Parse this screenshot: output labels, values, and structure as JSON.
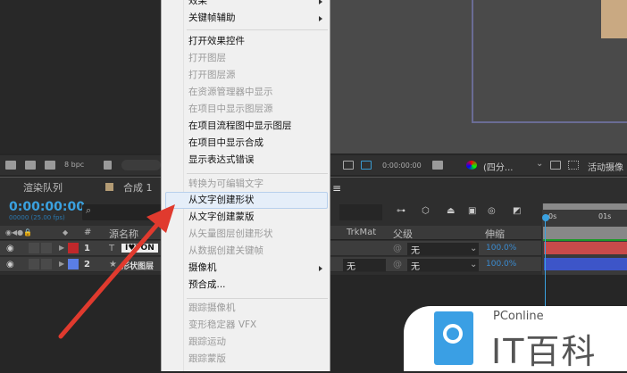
{
  "menu": {
    "items": [
      {
        "label": "效果",
        "disabled": false,
        "submenu": true
      },
      {
        "label": "关键帧辅助",
        "disabled": false,
        "submenu": true
      },
      {
        "label": "打开效果控件",
        "disabled": false
      },
      {
        "label": "打开图层",
        "disabled": true
      },
      {
        "label": "打开图层源",
        "disabled": true
      },
      {
        "label": "在资源管理器中显示",
        "disabled": true
      },
      {
        "label": "在项目中显示图层源",
        "disabled": true
      },
      {
        "label": "在项目流程图中显示图层",
        "disabled": false
      },
      {
        "label": "在项目中显示合成",
        "disabled": false
      },
      {
        "label": "显示表达式错误",
        "disabled": false
      },
      {
        "label": "转换为可编辑文字",
        "disabled": true
      },
      {
        "label": "从文字创建形状",
        "disabled": false,
        "highlighted": true
      },
      {
        "label": "从文字创建蒙版",
        "disabled": false
      },
      {
        "label": "从矢量图层创建形状",
        "disabled": true
      },
      {
        "label": "从数据创建关键帧",
        "disabled": true
      },
      {
        "label": "摄像机",
        "disabled": false,
        "submenu": true
      },
      {
        "label": "预合成...",
        "disabled": false
      },
      {
        "label": "跟踪摄像机",
        "disabled": true
      },
      {
        "label": "变形稳定器 VFX",
        "disabled": true
      },
      {
        "label": "跟踪运动",
        "disabled": true
      },
      {
        "label": "跟踪蒙版",
        "disabled": true
      }
    ]
  },
  "toolbar": {
    "bpc": "8 bpc",
    "timecode": "0:00:00:00",
    "resolution": "(四分...",
    "camera": "活动摄像"
  },
  "tabs": {
    "render_queue": "渲染队列",
    "comp": "合成 1"
  },
  "timeline": {
    "timecode": "0:00:00:00",
    "fps": "00000 (25.00 fps)",
    "search_icon": "⌕",
    "ruler": [
      "0s",
      "01s"
    ]
  },
  "columns": {
    "num": "#",
    "source": "源名称",
    "trkmat": "TrkMat",
    "parent": "父级",
    "stretch": "伸缩"
  },
  "layers": [
    {
      "num": "1",
      "type": "T",
      "name": "I♥TON",
      "color": "#c0282b",
      "trkmat": "",
      "parent": "无",
      "stretch": "100.0%",
      "bar": "#c94a4a"
    },
    {
      "num": "2",
      "type": "★",
      "name": "形状图层",
      "color": "#5a7ee6",
      "trkmat": "无",
      "parent": "无",
      "stretch": "100.0%",
      "bar": "#3d55c8"
    }
  ],
  "watermark": {
    "brand": "PConline",
    "name": "IT百科"
  },
  "colors": {
    "accent": "#3aa1e0",
    "highlight": "#e5eef9",
    "arrow": "#e03a2e"
  }
}
